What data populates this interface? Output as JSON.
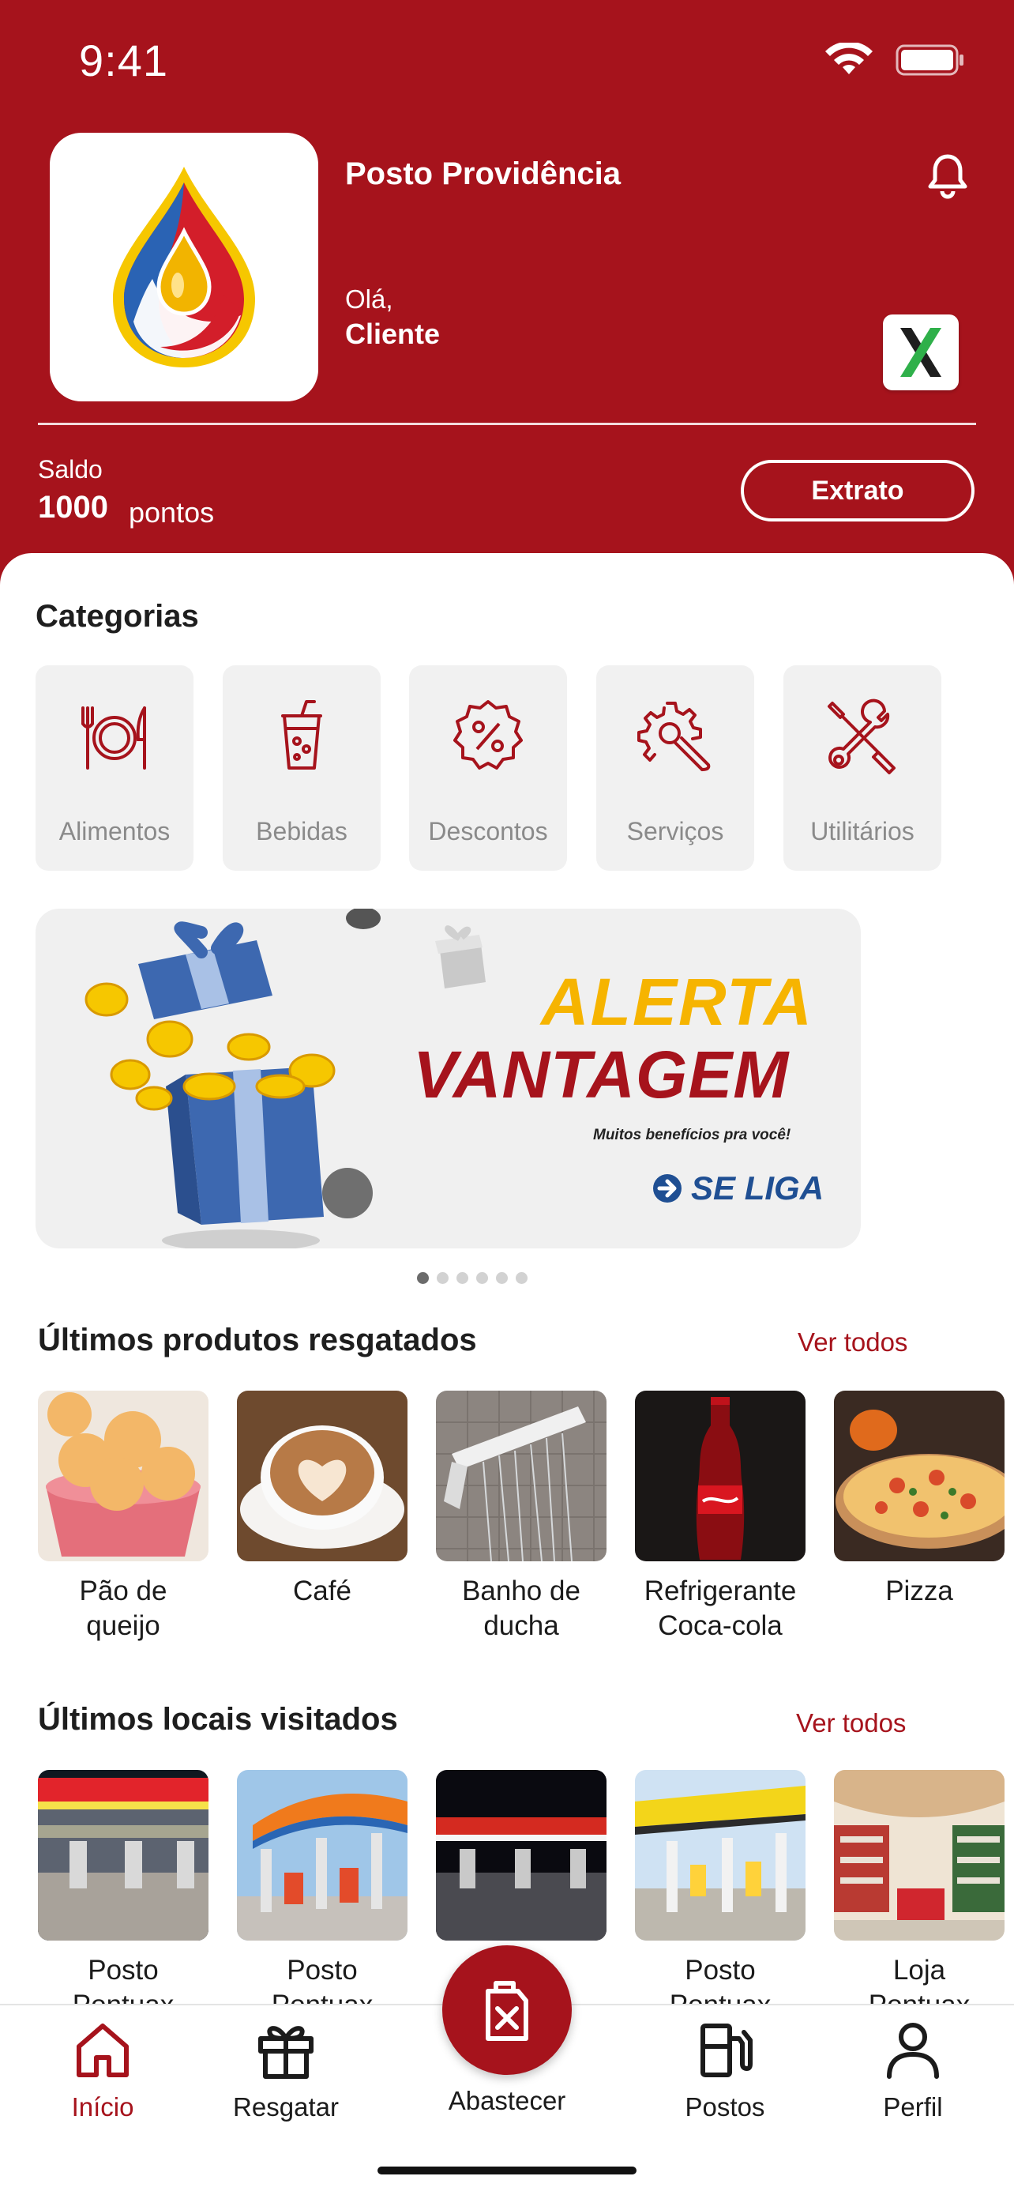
{
  "status_bar": {
    "time": "9:41"
  },
  "header": {
    "station_name": "Posto Providência",
    "greeting": "Olá,",
    "username": "Cliente",
    "balance_label": "Saldo",
    "balance_value": "1000",
    "balance_unit": "pontos",
    "extrato_label": "Extrato",
    "partner_badge_letter": "X"
  },
  "categories": {
    "title": "Categorias",
    "items": [
      {
        "label": "Alimentos",
        "icon": "plate-cutlery-icon"
      },
      {
        "label": "Bebidas",
        "icon": "drink-cup-icon"
      },
      {
        "label": "Descontos",
        "icon": "discount-badge-icon"
      },
      {
        "label": "Serviços",
        "icon": "gear-wrench-icon"
      },
      {
        "label": "Utilitários",
        "icon": "tools-icon"
      }
    ]
  },
  "banner": {
    "title_line1": "ALERTA",
    "title_line2": "VANTAGEM",
    "subtitle": "Muitos benefícios pra você!",
    "cta": "SE LIGA",
    "pages": 6,
    "active_page": 1
  },
  "products": {
    "title": "Últimos produtos resgatados",
    "see_all": "Ver todos",
    "items": [
      {
        "line1": "Pão de",
        "line2": "queijo"
      },
      {
        "line1": "Café",
        "line2": ""
      },
      {
        "line1": "Banho de",
        "line2": "ducha"
      },
      {
        "line1": "Refrigerante",
        "line2": "Coca-cola"
      },
      {
        "line1": "Pizza",
        "line2": ""
      }
    ]
  },
  "places": {
    "title": "Últimos locais visitados",
    "see_all": "Ver todos",
    "items": [
      {
        "line1": "Posto",
        "line2": "Pontuax"
      },
      {
        "line1": "Posto",
        "line2": "Pontuax"
      },
      {
        "line1": "",
        "line2": ""
      },
      {
        "line1": "Posto",
        "line2": "Pontuax"
      },
      {
        "line1": "Loja",
        "line2": "Pontuax"
      }
    ]
  },
  "nav": {
    "home": "Início",
    "redeem": "Resgatar",
    "refuel": "Abastecer",
    "stations": "Postos",
    "profile": "Perfil"
  },
  "colors": {
    "brand_red": "#a6131c",
    "banner_yellow": "#f6b400",
    "banner_blue": "#1f4f93"
  }
}
